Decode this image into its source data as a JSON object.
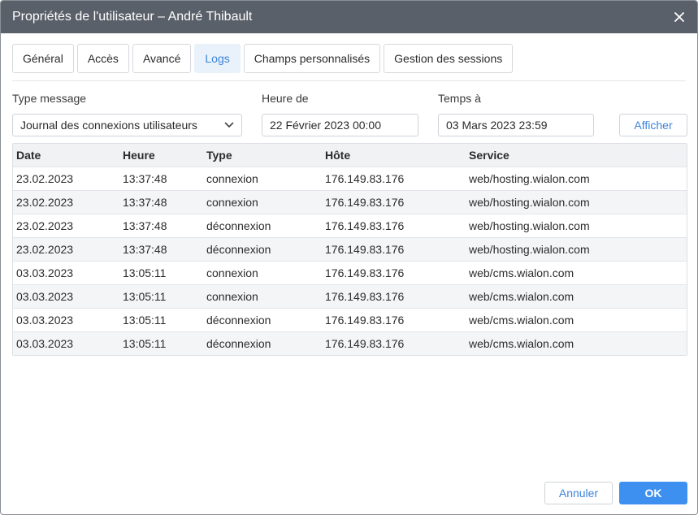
{
  "dialog": {
    "title": "Propriétés de l'utilisateur – André Thibault"
  },
  "tabs": [
    {
      "label": "Général",
      "active": false
    },
    {
      "label": "Accès",
      "active": false
    },
    {
      "label": "Avancé",
      "active": false
    },
    {
      "label": "Logs",
      "active": true
    },
    {
      "label": "Champs personnalisés",
      "active": false
    },
    {
      "label": "Gestion des sessions",
      "active": false
    }
  ],
  "filters": {
    "type_label": "Type message",
    "type_value": "Journal des connexions utilisateurs",
    "from_label": "Heure de",
    "from_value": "22 Février 2023 00:00",
    "to_label": "Temps à",
    "to_value": "03 Mars 2023 23:59",
    "show_button": "Afficher"
  },
  "table": {
    "columns": [
      "Date",
      "Heure",
      "Type",
      "Hôte",
      "Service"
    ],
    "rows": [
      [
        "23.02.2023",
        "13:37:48",
        "connexion",
        "176.149.83.176",
        "web/hosting.wialon.com"
      ],
      [
        "23.02.2023",
        "13:37:48",
        "connexion",
        "176.149.83.176",
        "web/hosting.wialon.com"
      ],
      [
        "23.02.2023",
        "13:37:48",
        "déconnexion",
        "176.149.83.176",
        "web/hosting.wialon.com"
      ],
      [
        "23.02.2023",
        "13:37:48",
        "déconnexion",
        "176.149.83.176",
        "web/hosting.wialon.com"
      ],
      [
        "03.03.2023",
        "13:05:11",
        "connexion",
        "176.149.83.176",
        "web/cms.wialon.com"
      ],
      [
        "03.03.2023",
        "13:05:11",
        "connexion",
        "176.149.83.176",
        "web/cms.wialon.com"
      ],
      [
        "03.03.2023",
        "13:05:11",
        "déconnexion",
        "176.149.83.176",
        "web/cms.wialon.com"
      ],
      [
        "03.03.2023",
        "13:05:11",
        "déconnexion",
        "176.149.83.176",
        "web/cms.wialon.com"
      ]
    ]
  },
  "footer": {
    "cancel_label": "Annuler",
    "ok_label": "OK"
  },
  "icons": {
    "close": "close-icon",
    "dropdown": "chevron-down-icon"
  },
  "colors": {
    "titlebar": "#5a6069",
    "accent": "#3d84d9",
    "primary_button": "#3d8ff0",
    "active_tab_bg": "#e9f1fb"
  }
}
